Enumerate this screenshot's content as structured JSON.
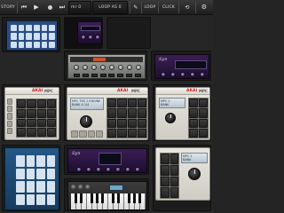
{
  "toolbar": {
    "history_label": "STORY",
    "counter_label": "mr 0",
    "loop_as_label": "LOOP AS 0",
    "loop_label": "LOOP",
    "click_label": "CLICK",
    "icons": [
      "prev-icon",
      "play-icon",
      "record-icon",
      "next-icon",
      "pencil-icon",
      "loop-icon",
      "settings-icon"
    ]
  },
  "modules": {
    "mpc_brand": "AKAI",
    "mpc_model": "MPC",
    "synth_brand": "Syn",
    "mpc_lcd_lines": [
      "MPC TRS 2 ENGINE",
      "BANK A 1/4"
    ],
    "mpc_lcd_small": [
      "MPC 1",
      "BANK"
    ],
    "synth_disp_text": ""
  },
  "colors": {
    "toolbar_bg": "#2a2a2a",
    "accent_red": "#c8201c",
    "synth_purple": "#3b1d57",
    "launchpad_blue": "#2a4c80"
  }
}
